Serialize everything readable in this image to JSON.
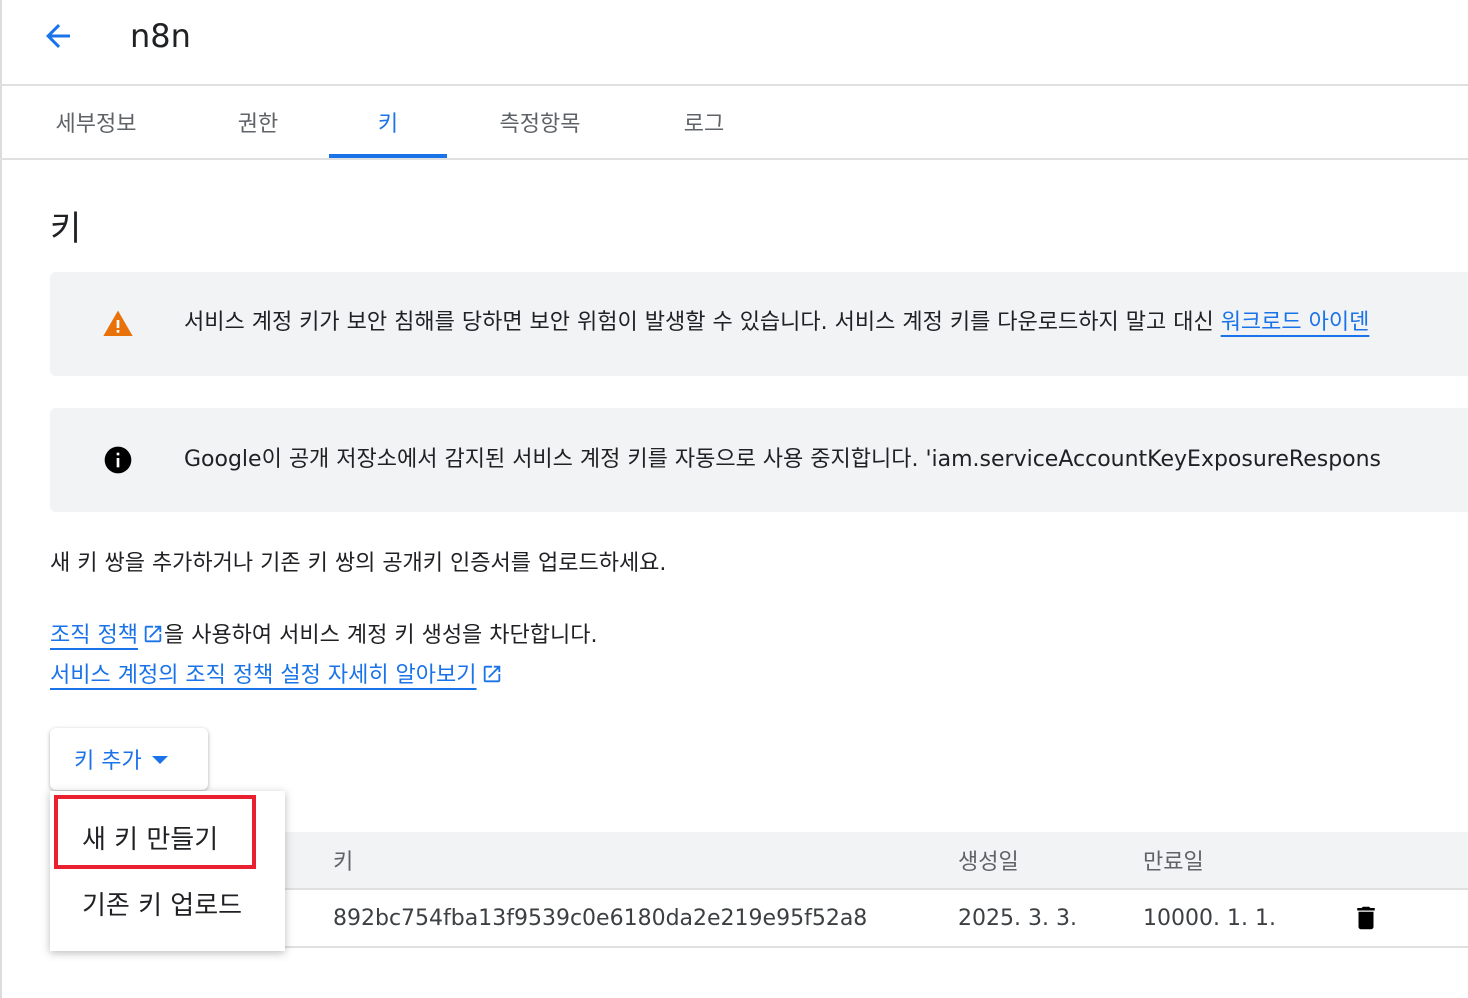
{
  "header": {
    "title": "n8n"
  },
  "tabs": [
    {
      "label": "세부정보",
      "active": false
    },
    {
      "label": "권한",
      "active": false
    },
    {
      "label": "키",
      "active": true
    },
    {
      "label": "측정항목",
      "active": false
    },
    {
      "label": "로그",
      "active": false
    }
  ],
  "section_title": "키",
  "warning_banner": {
    "text": "서비스 계정 키가 보안 침해를 당하면 보안 위험이 발생할 수 있습니다. 서비스 계정 키를 다운로드하지 말고 대신 ",
    "link": "워크로드 아이덴"
  },
  "info_banner": {
    "text": "Google이 공개 저장소에서 감지된 서비스 계정 키를 자동으로 사용 중지합니다. 'iam.serviceAccountKeyExposureRespons"
  },
  "description": "새 키 쌍을 추가하거나 기존 키 쌍의 공개키 인증서를 업로드하세요.",
  "policy": {
    "link": "조직 정책",
    "rest": "을 사용하여 서비스 계정 키 생성을 차단합니다.",
    "learn_more": "서비스 계정의 조직 정책 설정 자세히 알아보기"
  },
  "add_key": {
    "label": "키 추가",
    "menu": [
      "새 키 만들기",
      "기존 키 업로드"
    ]
  },
  "table": {
    "headers": [
      "키",
      "생성일",
      "만료일"
    ],
    "rows": [
      {
        "key": "892bc754fba13f9539c0e6180da2e219e95f52a8",
        "created": "2025. 3. 3.",
        "expires": "10000. 1. 1."
      }
    ]
  },
  "colors": {
    "accent": "#1a73e8",
    "warning": "#e8710a",
    "highlight": "#e8202f"
  }
}
